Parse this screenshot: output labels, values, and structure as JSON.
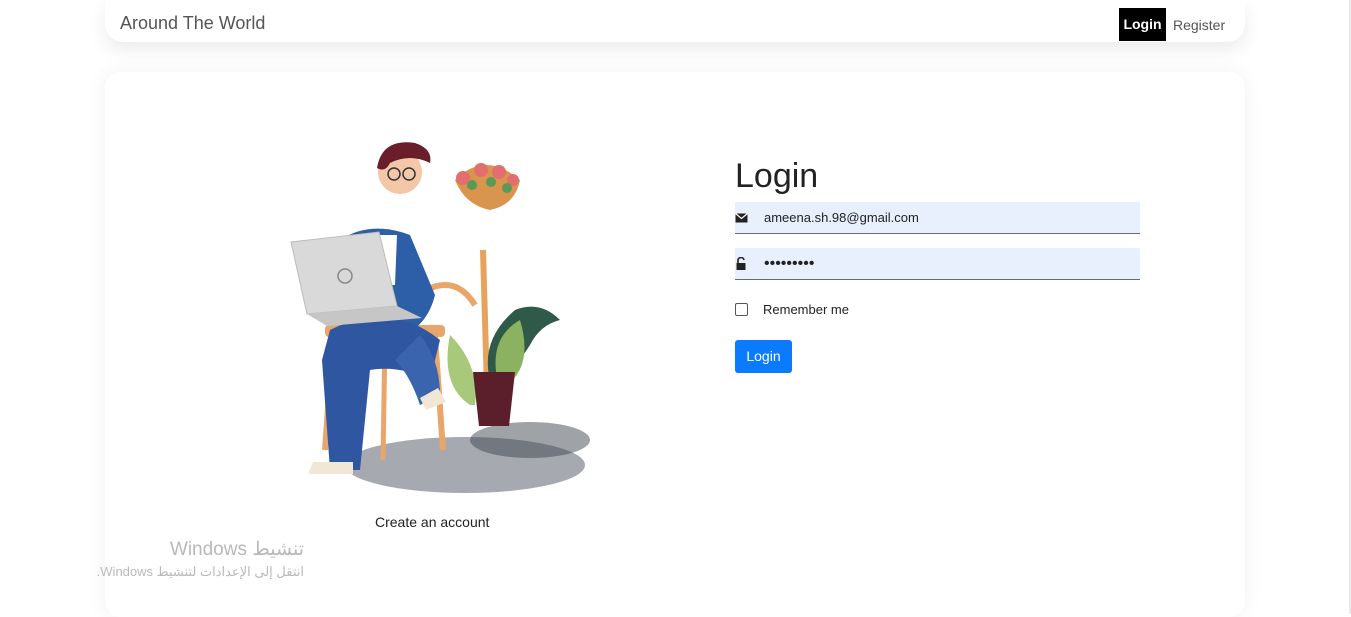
{
  "navbar": {
    "brand": "Around The World",
    "login_label": "Login",
    "register_label": "Register"
  },
  "card": {
    "create_account_label": "Create an account",
    "title": "Login",
    "email_value": "ameena.sh.98@gmail.com",
    "password_value": "•••••••••",
    "remember_label": "Remember me",
    "remember_checked": false,
    "login_button_label": "Login"
  },
  "watermark": {
    "title": "تنشيط Windows",
    "subtitle": "انتقل إلى الإعدادات لتنشيط Windows."
  },
  "icons": {
    "email": "envelope-icon",
    "password": "lock-icon"
  },
  "colors": {
    "accent": "#0a7bff",
    "nav_active_bg": "#000000",
    "input_bg": "#e8f0fe"
  }
}
